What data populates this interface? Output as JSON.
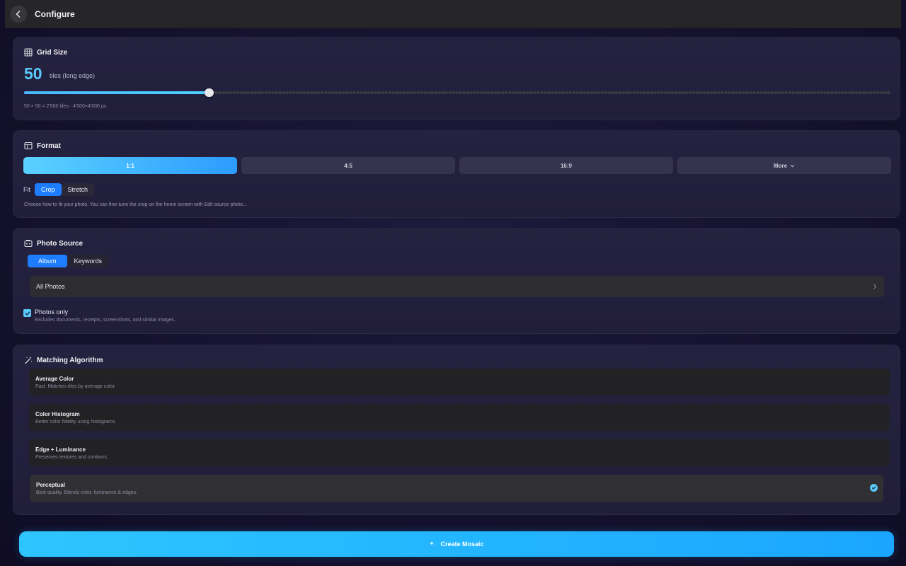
{
  "header": {
    "title": "Configure"
  },
  "grid_size": {
    "title": "Grid Size",
    "value": "50",
    "unit": "tiles (long edge)",
    "slider_fraction": 0.213,
    "info": "50 × 50 = 2'500 tiles · 4'000×4'000 px"
  },
  "format": {
    "title": "Format",
    "ratios": [
      "1:1",
      "4:5",
      "16:9"
    ],
    "more_label": "More",
    "selected_ratio": "1:1",
    "fit_label": "Fit",
    "fit_options": [
      "Crop",
      "Stretch"
    ],
    "selected_fit": "Crop",
    "help": "Choose how to fit your photo. You can fine-tune the crop on the home screen with Edit source photo..."
  },
  "photo_source": {
    "title": "Photo Source",
    "tabs": [
      "Album",
      "Keywords"
    ],
    "selected_tab": "Album",
    "album": "All Photos",
    "photos_only_label": "Photos only",
    "photos_only_desc": "Excludes documents, receipts, screenshots, and similar images.",
    "photos_only_checked": true
  },
  "matching": {
    "title": "Matching Algorithm",
    "options": [
      {
        "name": "Average Color",
        "desc": "Fast. Matches tiles by average color."
      },
      {
        "name": "Color Histogram",
        "desc": "Better color fidelity using histograms."
      },
      {
        "name": "Edge + Luminance",
        "desc": "Preserves textures and contours."
      },
      {
        "name": "Perceptual",
        "desc": "Best quality. Blends color, luminance & edges."
      }
    ],
    "selected": "Perceptual"
  },
  "create_button": {
    "label": "Create Mosaic"
  },
  "colors": {
    "accent": "#5ac8fa",
    "primary": "#1e7dff",
    "card": "#24213e",
    "background": "#15122e"
  },
  "icons": {
    "back": "chevron-left-icon",
    "grid": "grid-icon",
    "format": "aspect-ratio-icon",
    "source": "photo-library-icon",
    "matching": "magic-wand-icon",
    "create": "sparkles-icon"
  }
}
